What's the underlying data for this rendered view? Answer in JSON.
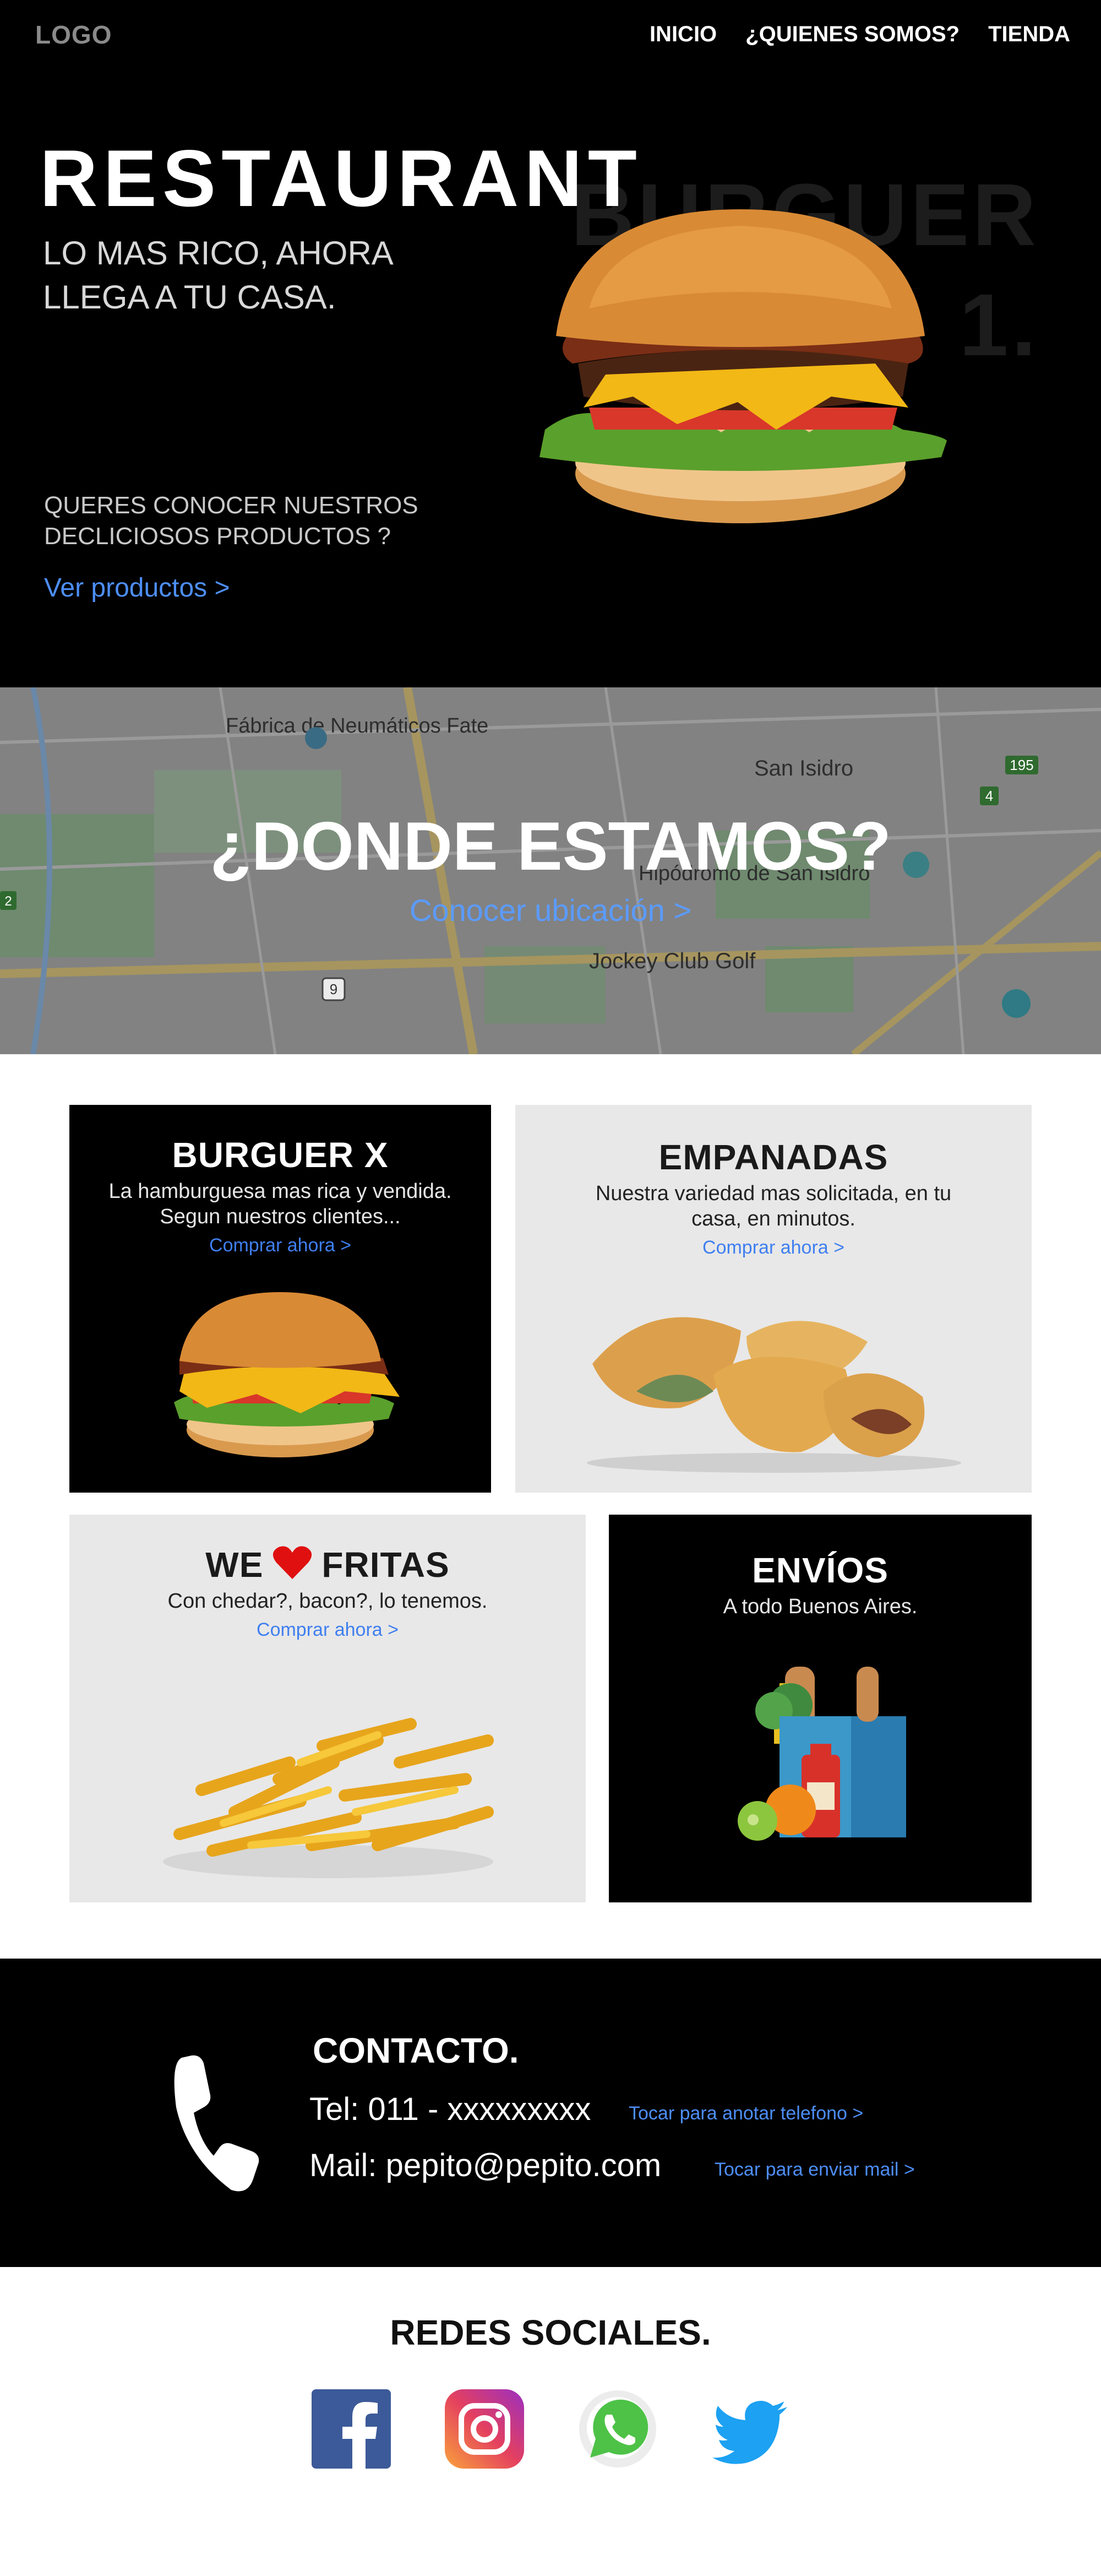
{
  "header": {
    "logo": "LOGO",
    "nav": [
      "INICIO",
      "¿QUIENES SOMOS?",
      "TIENDA"
    ]
  },
  "hero": {
    "title": "RESTAURANT",
    "subtitle": "LO MAS RICO, AHORA LLEGA A TU CASA.",
    "watermark_line1": "BURGUER",
    "watermark_line2": "1.",
    "question": "QUERES CONOCER NUESTROS DECLICIOSOS PRODUCTOS ?",
    "cta": "Ver productos >"
  },
  "location": {
    "title": "¿DONDE ESTAMOS?",
    "cta": "Conocer ubicación >",
    "map_labels": {
      "fabrica": "Fábrica de Neumáticos Fate",
      "san_isidro": "San Isidro",
      "hipodromo": "Hipódromo de San Isidro",
      "jockey": "Jockey Club Golf",
      "route_195": "195",
      "route_4": "4",
      "route_2": "2",
      "route_9": "9"
    }
  },
  "cards": {
    "burger": {
      "title": "BURGUER X",
      "desc": "La hamburguesa mas rica y vendida. Segun nuestros clientes...",
      "cta": "Comprar ahora >"
    },
    "empanadas": {
      "title": "EMPANADAS",
      "desc": "Nuestra variedad mas solicitada, en tu casa, en minutos.",
      "cta": "Comprar ahora >"
    },
    "fritas": {
      "title_a": "WE",
      "title_b": "FRITAS",
      "desc": "Con chedar?, bacon?, lo tenemos.",
      "cta": "Comprar ahora >"
    },
    "envios": {
      "title": "ENVÍOS",
      "desc": "A todo Buenos Aires."
    }
  },
  "contact": {
    "title": "CONTACTO.",
    "tel": "Tel: 011 - xxxxxxxxx",
    "tel_action": "Tocar para anotar telefono >",
    "mail": "Mail: pepito@pepito.com",
    "mail_action": "Tocar para enviar mail >"
  },
  "social": {
    "title": "REDES SOCIALES.",
    "networks": [
      "facebook",
      "instagram",
      "whatsapp",
      "twitter"
    ]
  },
  "colors": {
    "accent_link": "#4d8ef7",
    "dark_bg": "#000000",
    "light_card": "#e8e8e8",
    "heart": "#e01010"
  }
}
